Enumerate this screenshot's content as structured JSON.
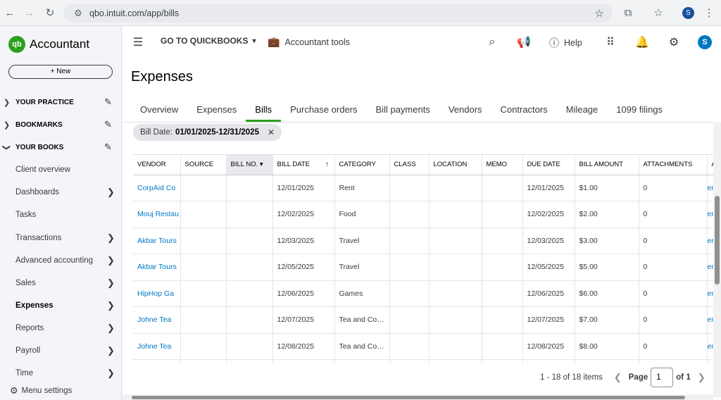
{
  "browser": {
    "url": "qbo.intuit.com/app/bills",
    "profile_initial": "S"
  },
  "app": {
    "logo_text": "qb",
    "name": "Accountant",
    "new_button": "+ New"
  },
  "sidebar": {
    "sections": [
      {
        "label": "YOUR PRACTICE"
      },
      {
        "label": "BOOKMARKS"
      },
      {
        "label": "YOUR BOOKS"
      }
    ],
    "items": [
      {
        "label": "Client overview"
      },
      {
        "label": "Dashboards"
      },
      {
        "label": "Tasks"
      },
      {
        "label": "Transactions"
      },
      {
        "label": "Advanced accounting"
      },
      {
        "label": "Sales"
      },
      {
        "label": "Expenses"
      },
      {
        "label": "Reports"
      },
      {
        "label": "Payroll"
      },
      {
        "label": "Time"
      }
    ],
    "menu_settings": "Menu settings"
  },
  "topbar": {
    "goto": "GO TO QUICKBOOKS",
    "accountant_tools": "Accountant tools",
    "help": "Help",
    "avatar": "S"
  },
  "page": {
    "title": "Expenses",
    "tabs": [
      "Overview",
      "Expenses",
      "Bills",
      "Purchase orders",
      "Bill payments",
      "Vendors",
      "Contractors",
      "Mileage",
      "1099 filings"
    ],
    "active_tab": "Bills"
  },
  "filter": {
    "label": "Bill Date:",
    "value": "01/01/2025-12/31/2025"
  },
  "table": {
    "columns": [
      "VENDOR",
      "SOURCE",
      "BILL NO.",
      "BILL DATE",
      "CATEGORY",
      "CLASS",
      "LOCATION",
      "MEMO",
      "DUE DATE",
      "BILL AMOUNT",
      "ATTACHMENTS",
      "A"
    ],
    "rows": [
      {
        "vendor": "CorpAid Co",
        "bill_date": "12/01/2025",
        "category": "Rent",
        "due_date": "12/01/2025",
        "amount": "$1.00",
        "attachments": "0",
        "action": "en"
      },
      {
        "vendor": "Mouj Restau",
        "bill_date": "12/02/2025",
        "category": "Food",
        "due_date": "12/02/2025",
        "amount": "$2.00",
        "attachments": "0",
        "action": "en"
      },
      {
        "vendor": "Akbar Tours",
        "bill_date": "12/03/2025",
        "category": "Travel",
        "due_date": "12/03/2025",
        "amount": "$3.00",
        "attachments": "0",
        "action": "en"
      },
      {
        "vendor": "Akbar Tours",
        "bill_date": "12/05/2025",
        "category": "Travel",
        "due_date": "12/05/2025",
        "amount": "$5.00",
        "attachments": "0",
        "action": "en"
      },
      {
        "vendor": "HipHop Ga",
        "bill_date": "12/06/2025",
        "category": "Games",
        "due_date": "12/06/2025",
        "amount": "$6.00",
        "attachments": "0",
        "action": "en"
      },
      {
        "vendor": "Johne Tea",
        "bill_date": "12/07/2025",
        "category": "Tea and Co…",
        "due_date": "12/07/2025",
        "amount": "$7.00",
        "attachments": "0",
        "action": "en"
      },
      {
        "vendor": "Johne Tea",
        "bill_date": "12/08/2025",
        "category": "Tea and Co…",
        "due_date": "12/08/2025",
        "amount": "$8.00",
        "attachments": "0",
        "action": "en"
      },
      {
        "vendor": "",
        "bill_date": "",
        "category": "",
        "due_date": "",
        "amount": "",
        "attachments": "",
        "action": ""
      }
    ]
  },
  "pagination": {
    "summary": "1 - 18 of 18 items",
    "page_label": "Page",
    "page_value": "1",
    "of_label": "of 1"
  },
  "colors": {
    "brand_green": "#2ca01c",
    "link_blue": "#0077c5"
  }
}
